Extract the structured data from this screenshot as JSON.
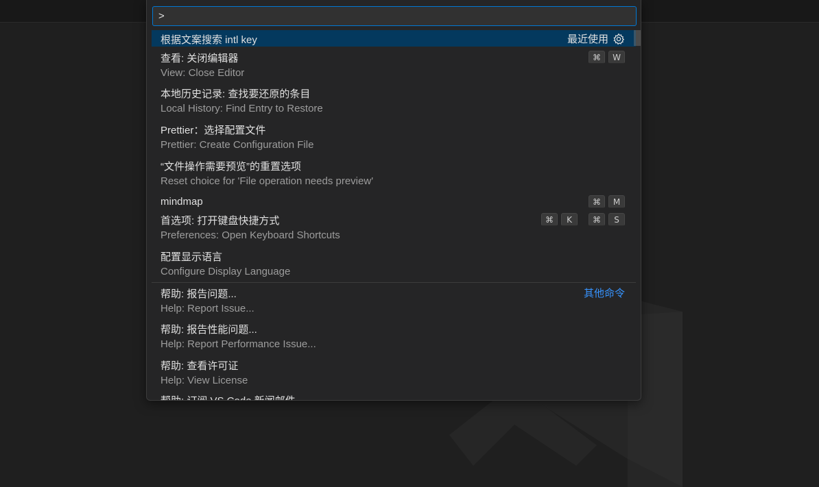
{
  "input": {
    "value": ">"
  },
  "items": [
    {
      "title": "根据文案搜索 intl key",
      "right_label": "最近使用"
    },
    {
      "title": "查看: 关闭编辑器",
      "subtitle": "View: Close Editor",
      "keys": [
        "⌘",
        "W"
      ]
    },
    {
      "title": "本地历史记录: 查找要还原的条目",
      "subtitle": "Local History: Find Entry to Restore"
    },
    {
      "title": "Prettier：选择配置文件",
      "subtitle": "Prettier: Create Configuration File"
    },
    {
      "title": "“文件操作需要预览”的重置选项",
      "subtitle": "Reset choice for 'File operation needs preview'"
    },
    {
      "title": "mindmap",
      "keys": [
        "⌘",
        "M"
      ]
    },
    {
      "title": "首选项: 打开键盘快捷方式",
      "subtitle": "Preferences: Open Keyboard Shortcuts",
      "keys": [
        "⌘",
        "K",
        "⌘",
        "S"
      ]
    },
    {
      "title": "配置显示语言",
      "subtitle": "Configure Display Language"
    },
    {
      "title": "帮助: 报告问题...",
      "subtitle": "Help: Report Issue...",
      "right_label": "其他命令"
    },
    {
      "title": "帮助: 报告性能问题...",
      "subtitle": "Help: Report Performance Issue..."
    },
    {
      "title": "帮助: 查看许可证",
      "subtitle": "Help: View License"
    },
    {
      "title": "帮助: 订阅 VS Code 新闻邮件"
    }
  ],
  "colors": {
    "accent": "#0078d4",
    "selected_bg": "#04395e",
    "link": "#3794ff"
  },
  "icons": {
    "settings": "gear-icon"
  }
}
